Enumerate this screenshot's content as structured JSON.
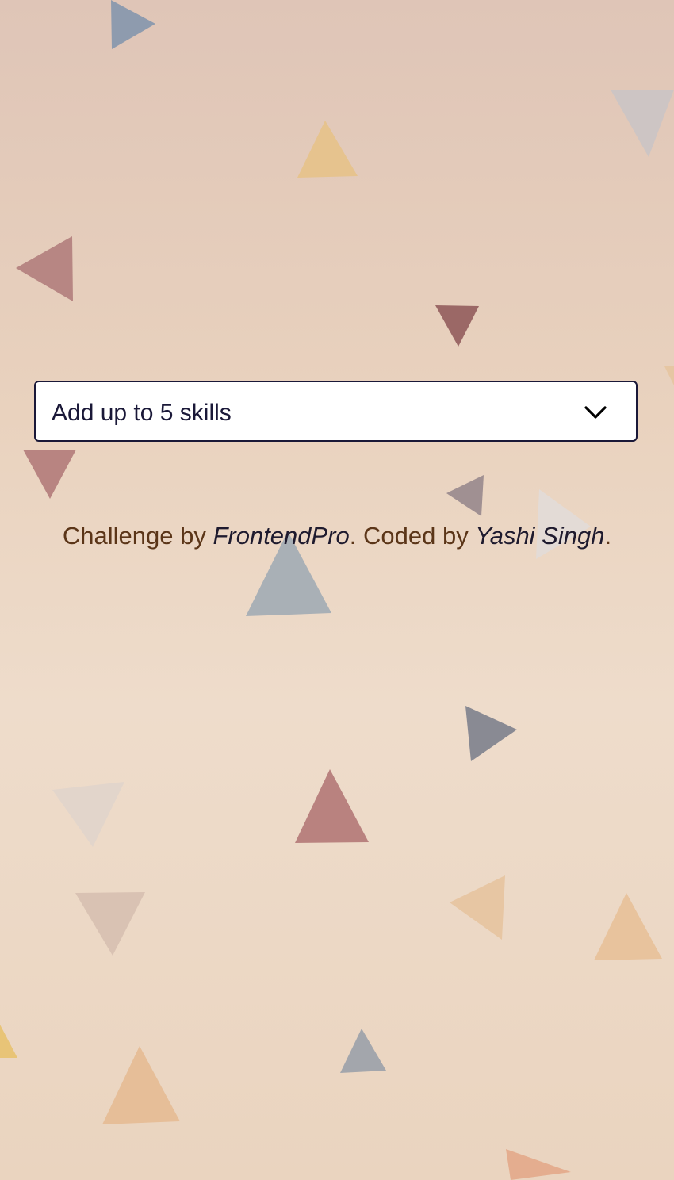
{
  "skills_select": {
    "placeholder": "Add up to 5 skills",
    "icon": "chevron-down-icon"
  },
  "footer": {
    "challenge_prefix": "Challenge by ",
    "challenge_author": "FrontendPro",
    "coded_prefix": ". Coded by ",
    "coder_name": "Yashi Singh",
    "suffix": "."
  },
  "colors": {
    "text_dark": "#1a1838",
    "footer_text": "#5b3518",
    "select_border": "#1a1838",
    "select_bg": "#ffffff",
    "background_top": "#dfc5b7",
    "background_bottom": "#ead4bf"
  }
}
